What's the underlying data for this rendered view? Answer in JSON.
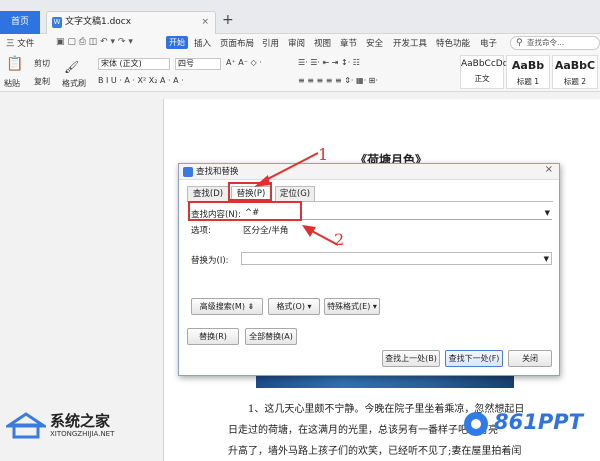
{
  "tabs": {
    "home": "首页",
    "doc": "文字文稿1.docx",
    "close": "×",
    "new": "+"
  },
  "menu": {
    "file": "三 文件",
    "items": [
      "插入",
      "页面布局",
      "引用",
      "审阅",
      "视图",
      "章节",
      "安全",
      "开发工具",
      "特色功能",
      "电子"
    ],
    "start": "开始",
    "search": "查找命令..."
  },
  "ribbon": {
    "paste": "粘贴",
    "cut": "剪切",
    "copy": "复制",
    "format_painter": "格式刷",
    "font": "宋体 (正文)",
    "size": "四号",
    "bold_italic": "B I U · A · X² X₂ A · A ·",
    "styles": [
      {
        "sample": "AaBbCcDd",
        "name": "正文"
      },
      {
        "sample": "AaBb",
        "name": "标题 1"
      },
      {
        "sample": "AaBbC",
        "name": "标题 2"
      }
    ]
  },
  "document": {
    "title": "《荷塘月色》",
    "lines": [
      "1、这几天心里颇不宁静。今晚在院子里坐着乘凉，忽然想起日",
      "日走过的荷塘，在这满月的光里，总该另有一番样子吧。月亮",
      "升高了，墙外马路上孩子们的欢笑，已经听不见了;妻在屋里拍着闰"
    ]
  },
  "dialog": {
    "title": "查找和替换",
    "close": "×",
    "tabs": [
      "查找(D)",
      "替换(P)",
      "定位(G)"
    ],
    "find_label": "查找内容(N):",
    "find_value": "^#",
    "options_label": "选项:",
    "options_value": "区分全/半角",
    "replace_label": "替换为(I):",
    "replace_value": "",
    "advanced": "高级搜索(M) ⇟",
    "format": "格式(O) ▾",
    "special": "特殊格式(E) ▾",
    "replace_btn": "替换(R)",
    "replace_all": "全部替换(A)",
    "find_prev": "查找上一处(B)",
    "find_next": "查找下一处(F)",
    "close_btn": "关闭"
  },
  "annotations": {
    "one": "1",
    "two": "2"
  },
  "watermarks": {
    "left_name": "系统之家",
    "left_url": "XITONGZHIJIA.NET",
    "right": "861PPT"
  },
  "colors": {
    "accent": "#2f73e0",
    "annotation": "#e03030"
  }
}
